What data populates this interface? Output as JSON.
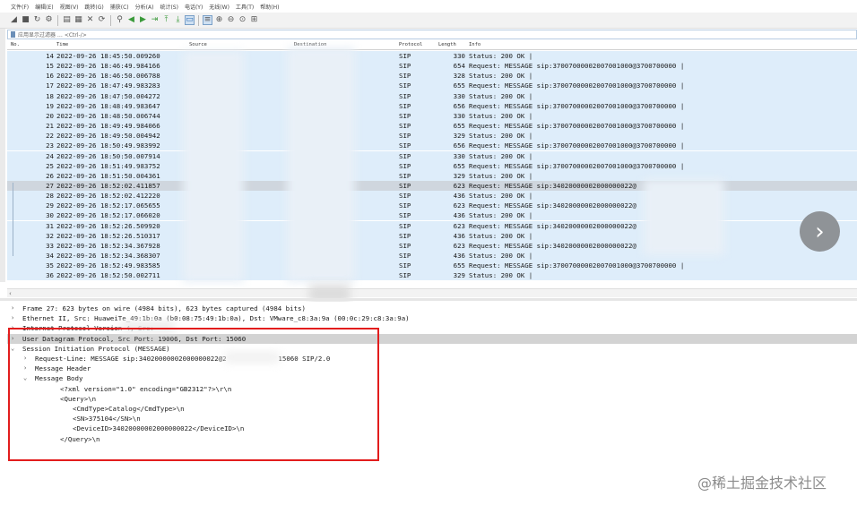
{
  "menu": [
    "文件(F)",
    "编辑(E)",
    "视图(V)",
    "跳转(G)",
    "捕获(C)",
    "分析(A)",
    "统计(S)",
    "电话(Y)",
    "无线(W)",
    "工具(T)",
    "帮助(H)"
  ],
  "toolbar_icons": [
    "shark-fin-icon",
    "stop-icon",
    "restart-icon",
    "options-icon",
    "open-icon",
    "save-icon",
    "close-file-icon",
    "reload-icon",
    "find-icon",
    "go-back-icon",
    "go-forward-icon",
    "go-to-packet-icon",
    "go-first-icon",
    "go-last-icon",
    "autoscroll-icon",
    "colorize-icon",
    "zoom-in-icon",
    "zoom-out-icon",
    "zoom-normal-icon",
    "resize-columns-icon"
  ],
  "filter": {
    "placeholder": "应用显示过滤器 … <Ctrl-/>"
  },
  "columns": {
    "no": "No.",
    "time": "Time",
    "source": "Source",
    "destination": "Destination",
    "protocol": "Protocol",
    "length": "Length",
    "info": "Info"
  },
  "packets": [
    {
      "no": "14",
      "time": "2022-09-26 18:45:50.009260",
      "protocol": "SIP",
      "length": "330",
      "info": "Status: 200 OK |"
    },
    {
      "no": "15",
      "time": "2022-09-26 18:46:49.984166",
      "protocol": "SIP",
      "length": "654",
      "info": "Request: MESSAGE sip:37007000002007001000@3700700000 |"
    },
    {
      "no": "16",
      "time": "2022-09-26 18:46:50.006788",
      "protocol": "SIP",
      "length": "328",
      "info": "Status: 200 OK |"
    },
    {
      "no": "17",
      "time": "2022-09-26 18:47:49.983283",
      "protocol": "SIP",
      "length": "655",
      "info": "Request: MESSAGE sip:37007000002007001000@3700700000 |"
    },
    {
      "no": "18",
      "time": "2022-09-26 18:47:50.004272",
      "protocol": "SIP",
      "length": "330",
      "info": "Status: 200 OK |"
    },
    {
      "no": "19",
      "time": "2022-09-26 18:48:49.983647",
      "protocol": "SIP",
      "length": "656",
      "info": "Request: MESSAGE sip:37007000002007001000@3700700000 |"
    },
    {
      "no": "20",
      "time": "2022-09-26 18:48:50.006744",
      "protocol": "SIP",
      "length": "330",
      "info": "Status: 200 OK |"
    },
    {
      "no": "21",
      "time": "2022-09-26 18:49:49.984066",
      "protocol": "SIP",
      "length": "655",
      "info": "Request: MESSAGE sip:37007000002007001000@3700700000 |"
    },
    {
      "no": "22",
      "time": "2022-09-26 18:49:50.004942",
      "protocol": "SIP",
      "length": "329",
      "info": "Status: 200 OK |"
    },
    {
      "no": "23",
      "time": "2022-09-26 18:50:49.983992",
      "protocol": "SIP",
      "length": "656",
      "info": "Request: MESSAGE sip:37007000002007001000@3700700000 |"
    },
    {
      "no": "24",
      "time": "2022-09-26 18:50:50.007914",
      "protocol": "SIP",
      "length": "330",
      "info": "Status: 200 OK |"
    },
    {
      "no": "25",
      "time": "2022-09-26 18:51:49.983752",
      "protocol": "SIP",
      "length": "655",
      "info": "Request: MESSAGE sip:37007000002007001000@3700700000 |"
    },
    {
      "no": "26",
      "time": "2022-09-26 18:51:50.004361",
      "protocol": "SIP",
      "length": "329",
      "info": "Status: 200 OK |"
    },
    {
      "no": "27",
      "time": "2022-09-26 18:52:02.411857",
      "protocol": "SIP",
      "length": "623",
      "info": "Request: MESSAGE sip:34020000002000000022@"
    },
    {
      "no": "28",
      "time": "2022-09-26 18:52:02.412220",
      "protocol": "SIP",
      "length": "436",
      "info": "Status: 200 OK |"
    },
    {
      "no": "29",
      "time": "2022-09-26 18:52:17.065655",
      "protocol": "SIP",
      "length": "623",
      "info": "Request: MESSAGE sip:34020000002000000022@"
    },
    {
      "no": "30",
      "time": "2022-09-26 18:52:17.066020",
      "protocol": "SIP",
      "length": "436",
      "info": "Status: 200 OK |"
    },
    {
      "no": "31",
      "time": "2022-09-26 18:52:26.509920",
      "protocol": "SIP",
      "length": "623",
      "info": "Request: MESSAGE sip:34020000002000000022@"
    },
    {
      "no": "32",
      "time": "2022-09-26 18:52:26.510317",
      "protocol": "SIP",
      "length": "436",
      "info": "Status: 200 OK |"
    },
    {
      "no": "33",
      "time": "2022-09-26 18:52:34.367928",
      "protocol": "SIP",
      "length": "623",
      "info": "Request: MESSAGE sip:34020000002000000022@"
    },
    {
      "no": "34",
      "time": "2022-09-26 18:52:34.368307",
      "protocol": "SIP",
      "length": "436",
      "info": "Status: 200 OK |"
    },
    {
      "no": "35",
      "time": "2022-09-26 18:52:49.983585",
      "protocol": "SIP",
      "length": "655",
      "info": "Request: MESSAGE sip:37007000002007001000@3700700000 |"
    },
    {
      "no": "36",
      "time": "2022-09-26 18:52:50.002711",
      "protocol": "SIP",
      "length": "329",
      "info": "Status: 200 OK |"
    }
  ],
  "selected_packet": "27",
  "details": [
    {
      "text": "Frame 27: 623 bytes on wire (4984 bits), 623 bytes captured (4984 bits)",
      "arrow": ">",
      "indent": 0
    },
    {
      "text": "Ethernet II, Src: HuaweiTe_49:1b:0a (b0:08:75:49:1b:0a), Dst: VMware_c8:3a:9a (00:0c:29:c8:3a:9a)",
      "arrow": ">",
      "indent": 0
    },
    {
      "text": "Internet Protocol Version 4, Src:",
      "arrow": ">",
      "indent": 0
    },
    {
      "text": "User Datagram Protocol, Src Port: 19006, Dst Port: 15060",
      "arrow": ">",
      "indent": 0,
      "highlight": true
    },
    {
      "text": "Session Initiation Protocol (MESSAGE)",
      "arrow": "v",
      "indent": 0
    },
    {
      "text": "Request-Line: MESSAGE sip:34020000002000000022@2             15060 SIP/2.0",
      "arrow": ">",
      "indent": 1
    },
    {
      "text": "Message Header",
      "arrow": ">",
      "indent": 1
    },
    {
      "text": "Message Body",
      "arrow": "v",
      "indent": 1
    },
    {
      "text": "<?xml version=\"1.0\" encoding=\"GB2312\"?>\\r\\n",
      "arrow": "",
      "indent": 3
    },
    {
      "text": "<Query>\\n",
      "arrow": "",
      "indent": 3
    },
    {
      "text": "<CmdType>Catalog</CmdType>\\n",
      "arrow": "",
      "indent": 4
    },
    {
      "text": "<SN>375104</SN>\\n",
      "arrow": "",
      "indent": 4
    },
    {
      "text": "<DeviceID>34020000002000000022</DeviceID>\\n",
      "arrow": "",
      "indent": 4
    },
    {
      "text": "</Query>\\n",
      "arrow": "",
      "indent": 3
    }
  ],
  "watermark": "@稀土掘金技术社区",
  "colors": {
    "row_bg": "#deedfa",
    "selected_bg": "#cfd6de",
    "annotation": "#e21d1d"
  }
}
